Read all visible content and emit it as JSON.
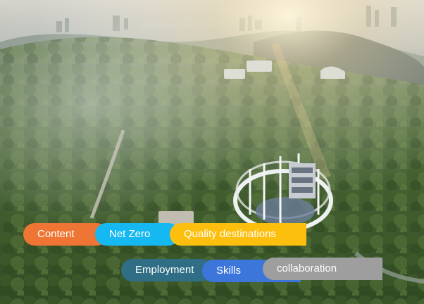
{
  "tags_row1": [
    {
      "label": "Content",
      "color": "#EE7533"
    },
    {
      "label": "Net Zero",
      "color": "#15B8F0"
    },
    {
      "label": "Quality destinations",
      "color": "#FDBF0E"
    }
  ],
  "tags_row2": [
    {
      "label": "Employment",
      "color": "#2F6E84"
    },
    {
      "label": "Skills",
      "color": "#3D76DB"
    },
    {
      "label": "collaboration",
      "color": "#9E9E9E"
    }
  ]
}
